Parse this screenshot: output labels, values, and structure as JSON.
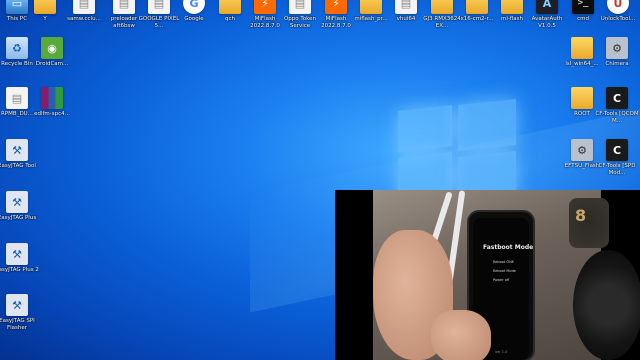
{
  "desktop": {
    "top_row": [
      {
        "label": "This PC",
        "icon": "this-pc-icon"
      },
      {
        "label": "Y",
        "icon": "folder-icon"
      },
      {
        "label": "samw.cclu...",
        "icon": "file-icon"
      },
      {
        "label": "preloader aft6bsw",
        "icon": "file-icon"
      },
      {
        "label": "GOOGLE PIXEL 5...",
        "icon": "file-icon"
      },
      {
        "label": "Google",
        "icon": "google-icon"
      },
      {
        "label": "qch",
        "icon": "folder-icon"
      },
      {
        "label": "MiFlash 2022.8.7.0",
        "icon": "mi-flash-icon"
      },
      {
        "label": "Oppo Token Service",
        "icon": "file-icon"
      },
      {
        "label": "MiFlash 2022.8.7.0",
        "icon": "mi-flash-icon"
      },
      {
        "label": "miflash_pr...",
        "icon": "folder-icon"
      },
      {
        "label": "vhui64",
        "icon": "file-icon"
      },
      {
        "label": "GJ3 RMX3624 EX...",
        "icon": "folder-icon"
      },
      {
        "label": "x16-cm2-r...",
        "icon": "folder-icon"
      },
      {
        "label": "mi-flash",
        "icon": "folder-icon"
      },
      {
        "label": "AvatarAuth V1.0.5",
        "icon": "avatar-icon"
      },
      {
        "label": "cmd",
        "icon": "cmd-icon"
      },
      {
        "label": "UnlockTool...",
        "icon": "unlock-tool-icon"
      }
    ],
    "left_col": [
      {
        "label": "Recycle Bin",
        "icon": "recycle-bin-icon"
      },
      {
        "label": "DroidCam...",
        "icon": "android-icon"
      },
      {
        "label": "RPMB_DU...",
        "icon": "file-icon"
      },
      {
        "label": "edlfm-spc4...",
        "icon": "winrar-icon"
      },
      {
        "label": "EasyJTAG Tool",
        "icon": "easyjtag-icon"
      },
      {
        "label": "EasyJTAG Plus",
        "icon": "easyjtag-icon"
      },
      {
        "label": "EasyJTAG Plus 2",
        "icon": "easyjtag-icon"
      },
      {
        "label": "EasyJTAG SPI Flasher",
        "icon": "easyjtag-icon"
      }
    ],
    "right_col": [
      {
        "label": "lsl_win64_...",
        "icon": "folder-icon"
      },
      {
        "label": "Chimera",
        "icon": "chimera-icon"
      },
      {
        "label": "ROOT",
        "icon": "folder-icon"
      },
      {
        "label": "CF-Tools [QCOM M...",
        "icon": "cf-tools-icon"
      },
      {
        "label": "EFTSU_Flash",
        "icon": "eft-icon"
      },
      {
        "label": "CF-Tools [SPD Mod...",
        "icon": "cf-tools-icon"
      }
    ]
  },
  "video": {
    "phone": {
      "title": "Fastboot Mode",
      "options": [
        "Reboot ONE",
        "Reboot Mode",
        "Power off"
      ],
      "footer": "ver 1.0"
    },
    "mark": "8"
  }
}
